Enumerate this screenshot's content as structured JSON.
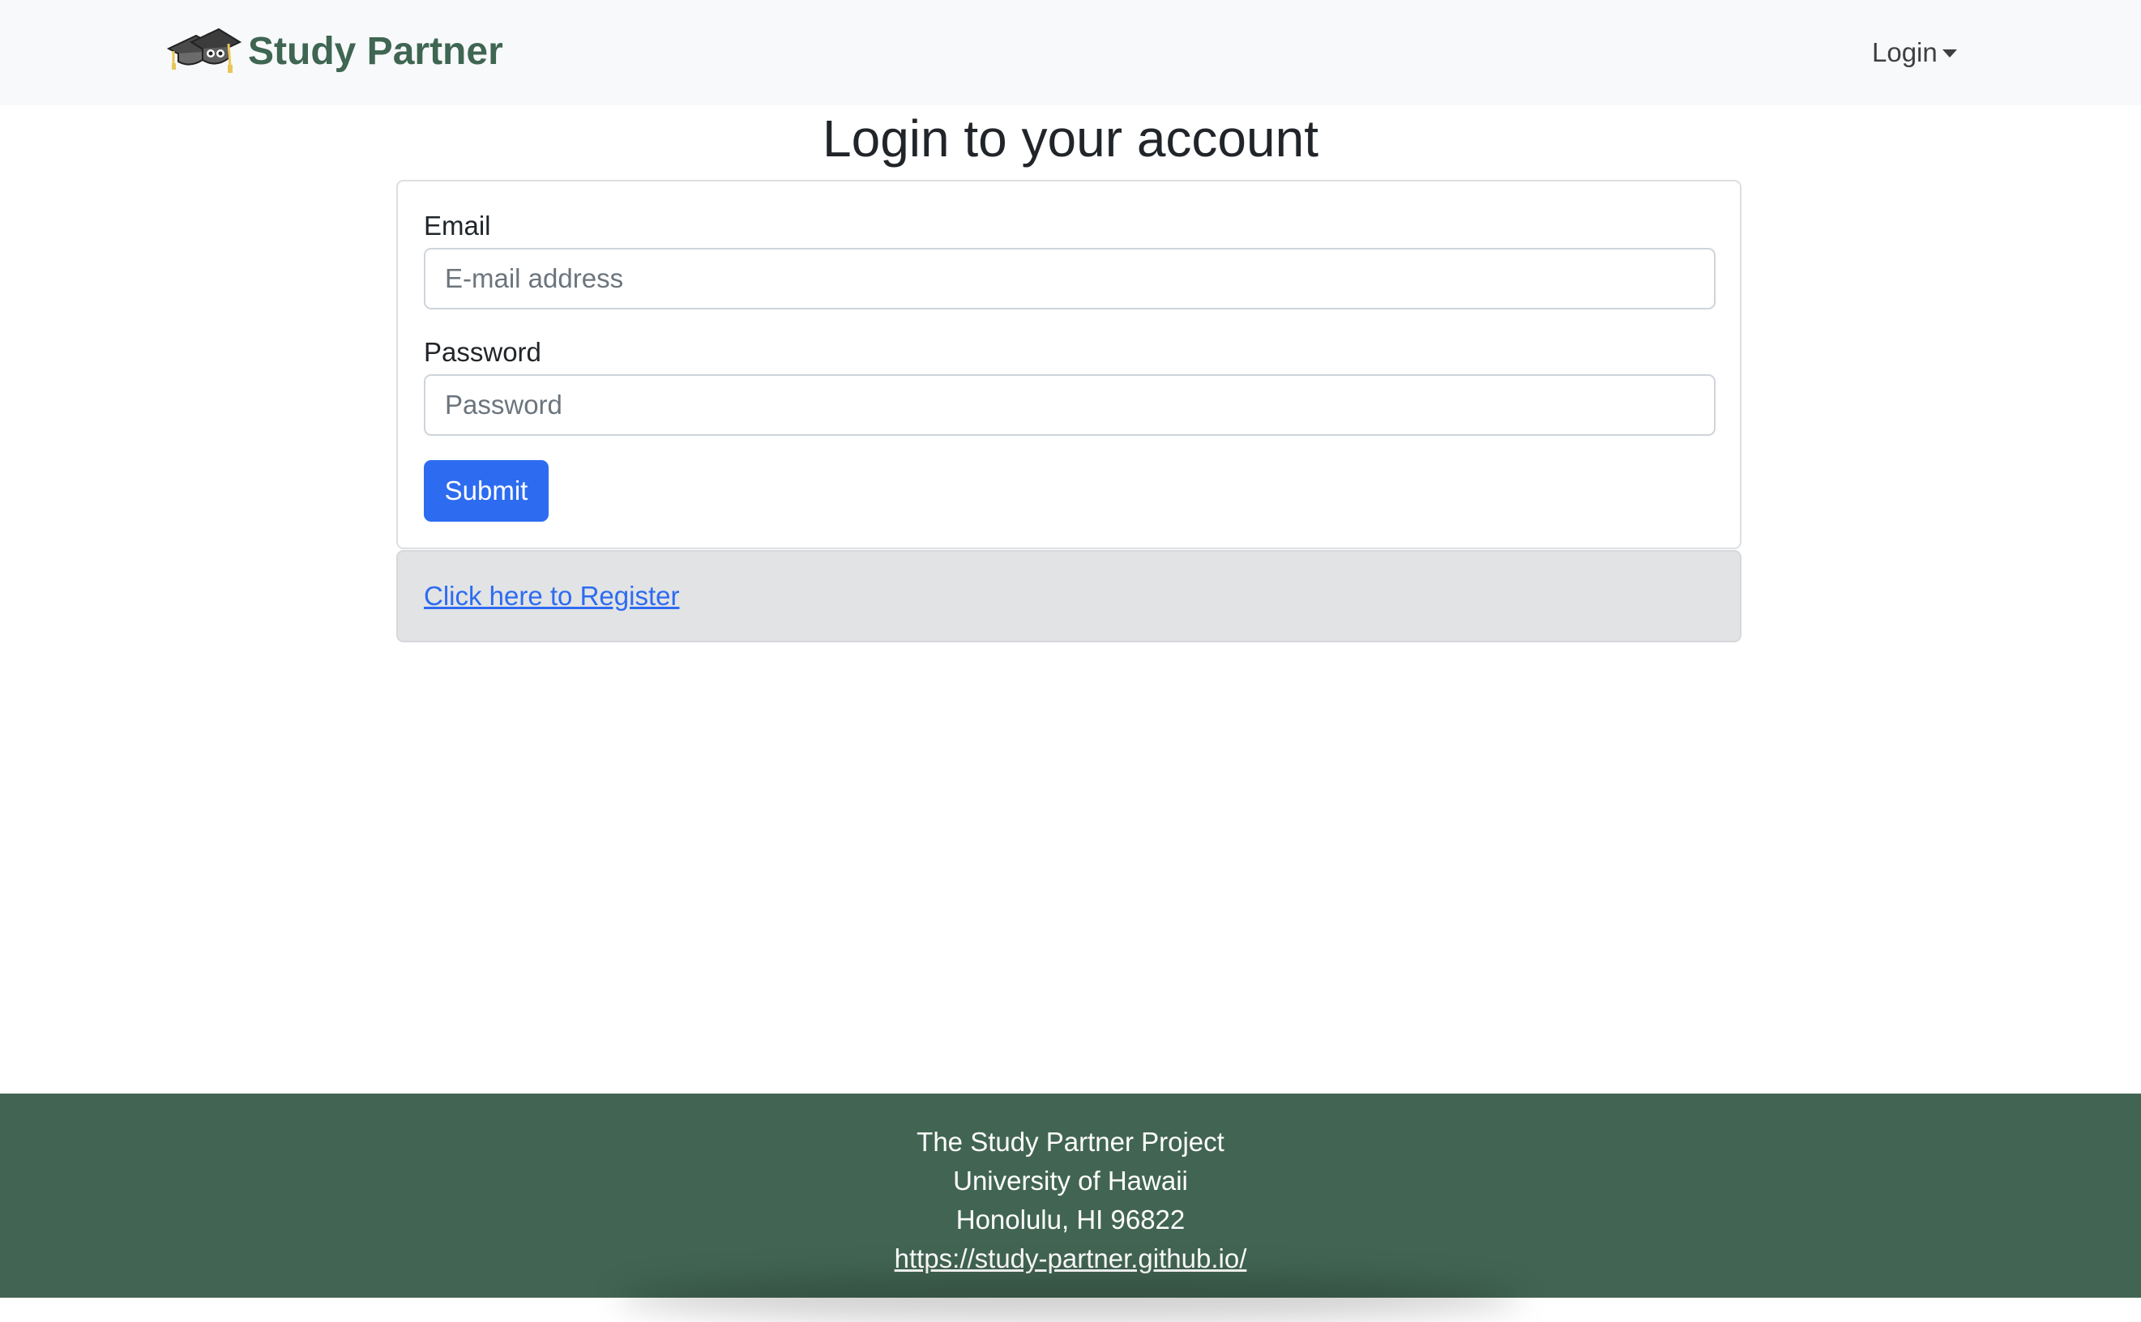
{
  "navbar": {
    "brand_name": "Study Partner",
    "login_label": "Login"
  },
  "main": {
    "title": "Login to your account",
    "email": {
      "label": "Email",
      "placeholder": "E-mail address",
      "value": ""
    },
    "password": {
      "label": "Password",
      "placeholder": "Password",
      "value": ""
    },
    "submit_label": "Submit",
    "register_link": "Click here to Register"
  },
  "footer": {
    "line1": "The Study Partner Project",
    "line2": "University of Hawaii",
    "line3": "Honolulu, HI 96822",
    "link": "https://study-partner.github.io/"
  },
  "colors": {
    "brand": "#3f6652",
    "footer_bg": "#426553",
    "primary": "#2d6cf0",
    "navbar_bg": "#f8f9fa",
    "register_bg": "#e2e3e5"
  },
  "icons": {
    "logo": "graduation-cap-logo-icon",
    "dropdown": "caret-down-icon"
  }
}
